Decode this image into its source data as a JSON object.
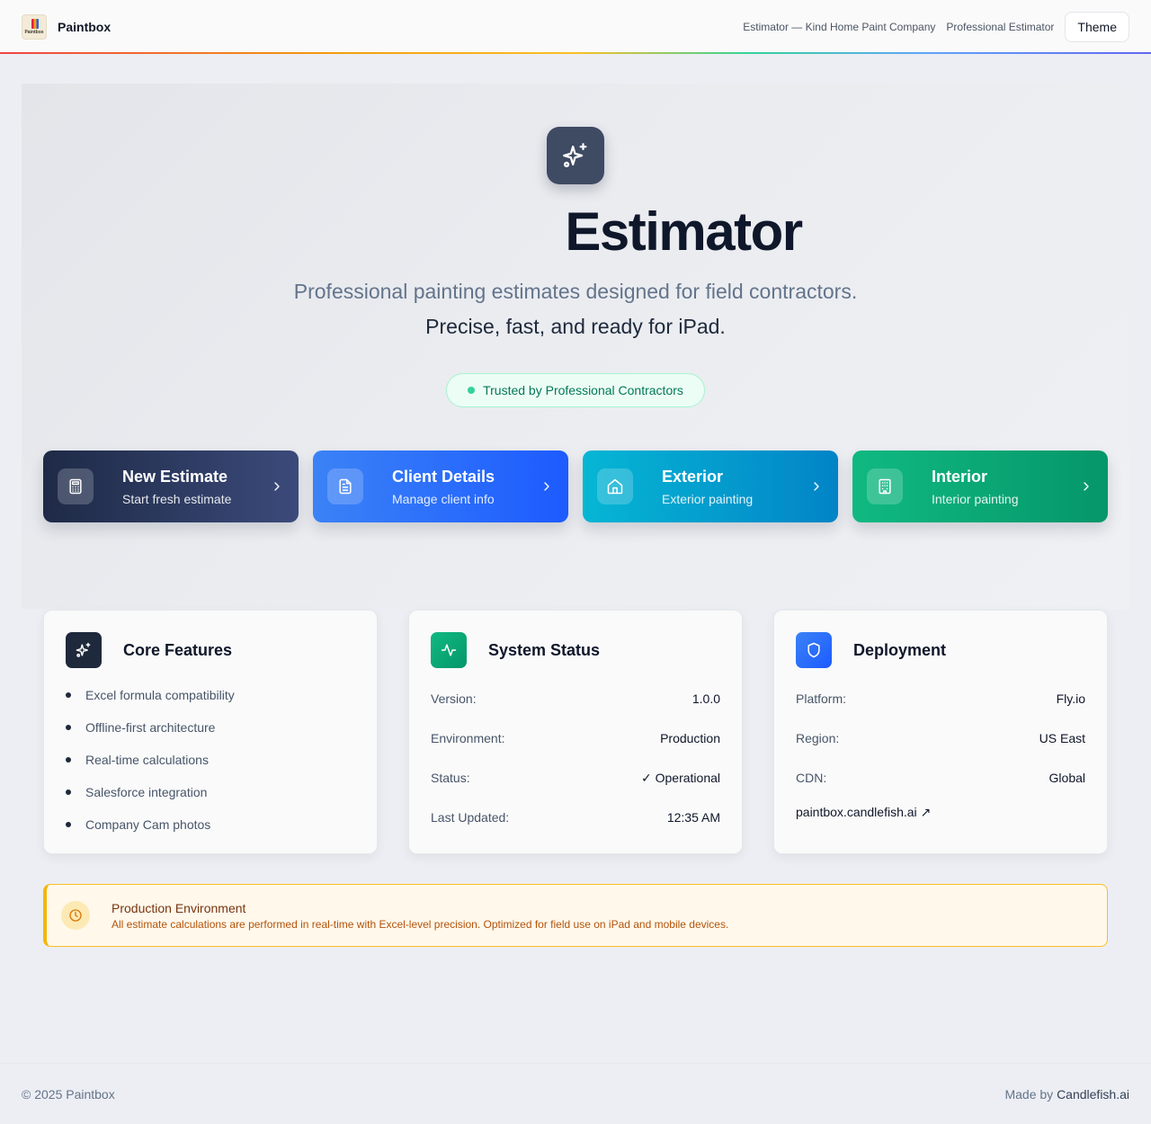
{
  "header": {
    "brand": "Paintbox",
    "logo_text": "Paintbox",
    "subtitle": "Estimator — Kind Home Paint Company",
    "role": "Professional Estimator",
    "theme_label": "Theme"
  },
  "hero": {
    "icon": "sparkles-icon",
    "title": "Estimator",
    "subtitle1": "Professional painting estimates designed for field contractors.",
    "subtitle2": "Precise, fast, and ready for iPad.",
    "badge": "Trusted by Professional Contractors",
    "actions": [
      {
        "title": "New Estimate",
        "subtitle": "Start fresh estimate",
        "icon": "calculator-icon"
      },
      {
        "title": "Client Details",
        "subtitle": "Manage client info",
        "icon": "document-icon"
      },
      {
        "title": "Exterior",
        "subtitle": "Exterior painting",
        "icon": "home-icon"
      },
      {
        "title": "Interior",
        "subtitle": "Interior painting",
        "icon": "building-icon"
      }
    ]
  },
  "features": {
    "title": "Core Features",
    "items": [
      "Excel formula compatibility",
      "Offline-first architecture",
      "Real-time calculations",
      "Salesforce integration",
      "Company Cam photos"
    ]
  },
  "status": {
    "title": "System Status",
    "rows": [
      {
        "key": "Version:",
        "value": "1.0.0"
      },
      {
        "key": "Environment:",
        "value": "Production"
      },
      {
        "key": "Status:",
        "value": "✓ Operational"
      },
      {
        "key": "Last Updated:",
        "value": "12:35 AM"
      }
    ]
  },
  "deployment": {
    "title": "Deployment",
    "rows": [
      {
        "key": "Platform:",
        "value": "Fly.io"
      },
      {
        "key": "Region:",
        "value": "US East"
      },
      {
        "key": "CDN:",
        "value": "Global"
      }
    ],
    "link": "paintbox.candlefish.ai ↗"
  },
  "alert": {
    "title": "Production Environment",
    "body": "All estimate calculations are performed in real-time with Excel-level precision. Optimized for field use on iPad and mobile devices."
  },
  "footer": {
    "copyright": "© 2025 Paintbox",
    "made_by_prefix": "Made by ",
    "made_by_name": "Candlefish.ai"
  },
  "colors": {
    "status_green": "#10b981",
    "deploy_blue": "#2563eb",
    "features_dark": "#1e293b",
    "alert_amber": "#f5b50a"
  }
}
